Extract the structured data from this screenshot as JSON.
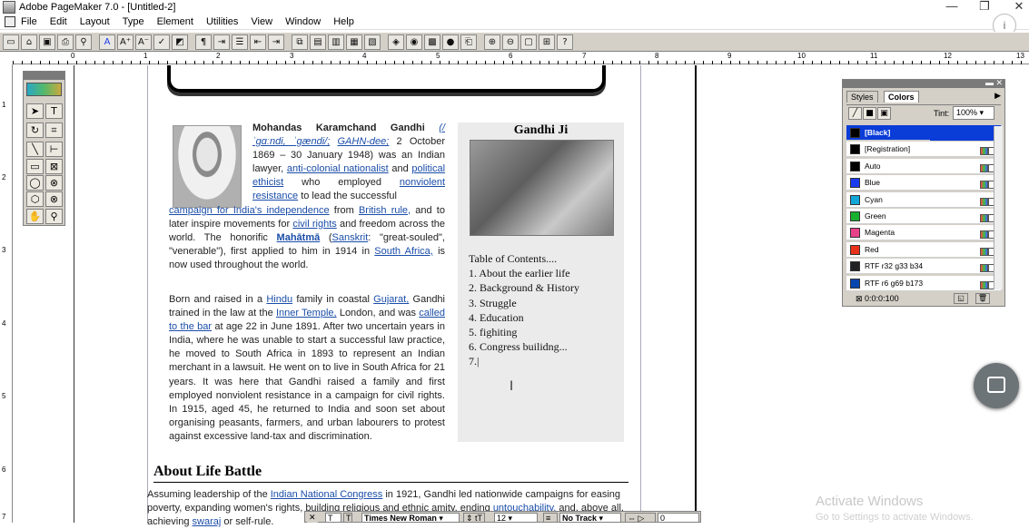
{
  "window": {
    "title": "Adobe PageMaker 7.0 - [Untitled-2]"
  },
  "menubar": [
    "File",
    "Edit",
    "Layout",
    "Type",
    "Element",
    "Utilities",
    "View",
    "Window",
    "Help"
  ],
  "toolbar": {
    "buttons": [
      "new",
      "open",
      "save",
      "print",
      "find",
      "char-A",
      "A+",
      "A-",
      "spell",
      "frame",
      "para",
      "indent",
      "bullets",
      "outdent",
      "in",
      "copy",
      "paste",
      "x1",
      "x2",
      "x3",
      "img1",
      "img2",
      "img3",
      "globe",
      "pdf",
      "zoom-in",
      "zoom-out",
      "100",
      "fit",
      "help"
    ]
  },
  "ruler": {
    "h_labels": [
      "0",
      "1",
      "2",
      "3",
      "4",
      "5",
      "6",
      "7",
      "8",
      "9",
      "10",
      "11",
      "12",
      "13"
    ],
    "v_labels": [
      "1",
      "2",
      "3",
      "4",
      "5",
      "6",
      "7"
    ]
  },
  "article": {
    "name_bold": "Mohandas Karamchand Gandhi",
    "pron": "(/ ˈɡɑːndi, ˈɡændi/;",
    "pron2": "GAHN-dee;",
    "p1a": " 2 October 1869 – 30 January 1948) was an Indian lawyer,",
    "l_anticolonial": "anti-colonial nationalist",
    "p1b": " and ",
    "l_political": "political ethicist",
    "p1c": " who employed ",
    "l_nonviolent": "nonviolent resistance",
    "p1d": " to lead the successful ",
    "l_campaign": "campaign for India's independence",
    "p1e": " from ",
    "l_british": "British rule,",
    "p1f": " and to later inspire movements for ",
    "l_civil": "civil rights",
    "p1g": " and freedom across the world. The honorific ",
    "l_mahatma": "Mahātmā",
    "p1h": " (",
    "l_sanskrit": "Sanskrit",
    "p1i": ": \"great-souled\", \"venerable\"), first applied to him in 1914 in ",
    "l_southafrica": "South Africa,",
    "p1j": " is now used throughout the world.",
    "p2a": "Born and raised in a ",
    "l_hindu": "Hindu",
    "p2b": " family in coastal ",
    "l_gujarat": "Gujarat,",
    "p2c": " Gandhi trained in the law at the ",
    "l_inner": "Inner Temple,",
    "p2d": " London, and was ",
    "l_bar": "called to the bar",
    "p2e": " at age 22 in June 1891. After two uncertain years in India, where he was unable to start a successful law practice, he moved to South Africa in 1893 to represent an Indian merchant in a lawsuit. He went on to live in South Africa for 21 years. It was here that Gandhi raised a family and first employed nonviolent resistance in a campaign for civil rights. In 1915, aged 45, he returned to India and soon set about organising peasants, farmers, and urban labourers to protest against excessive land-tax and discrimination."
  },
  "sidebar": {
    "title": "Gandhi Ji",
    "toc_header": "Table of Contents....",
    "toc": [
      "1. About the earlier life",
      "2. Background & History",
      "3. Struggle",
      "4. Education",
      "5. fighiting",
      "6. Congress builidng...",
      "7."
    ]
  },
  "section2": {
    "heading": "About Life Battle",
    "p3a": "Assuming leadership of the ",
    "l_inc": "Indian National Congress",
    "p3b": " in 1921, Gandhi led nationwide campaigns for easing poverty, expanding women's rights, building religious and ethnic amity, ending ",
    "l_untouch": "untouchability,",
    "p3c": " and, above all, achieving ",
    "l_swaraj": "swaraj",
    "p3d": " or self-rule."
  },
  "colors_panel": {
    "tabs": [
      "Styles",
      "Colors"
    ],
    "tint_label": "Tint:",
    "tint_value": "100%",
    "items": [
      {
        "name": "[Black]",
        "color": "#000000"
      },
      {
        "name": "[Registration]",
        "color": "#000000"
      },
      {
        "name": "Auto",
        "color": "#000000"
      },
      {
        "name": "Blue",
        "color": "#1a3cf0"
      },
      {
        "name": "Cyan",
        "color": "#13a6d8"
      },
      {
        "name": "Green",
        "color": "#18b02e"
      },
      {
        "name": "Magenta",
        "color": "#e8418a"
      },
      {
        "name": "Red",
        "color": "#e8321c"
      },
      {
        "name": "RTF r32 g33 b34",
        "color": "#202122"
      },
      {
        "name": "RTF r6 g69 b173",
        "color": "#0645ad"
      }
    ],
    "footer": "0:0:0:100"
  },
  "control_palette": {
    "font": "Times New Roman",
    "size": "12",
    "tracking": "No Track",
    "value": "0"
  },
  "watermark": {
    "line1": "Activate Windows",
    "line2": "Go to Settings to activate Windows."
  }
}
